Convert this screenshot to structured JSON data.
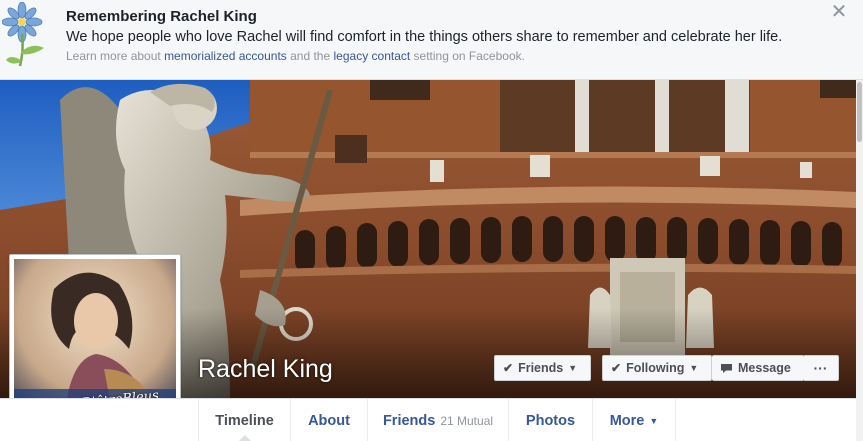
{
  "memorial": {
    "title": "Remembering Rachel King",
    "message": "We hope people who love Rachel will find comfort in the things others share to remember and celebrate her life.",
    "learn_prefix": "Learn more about ",
    "link_memorialized": "memorialized accounts",
    "learn_middle": " and the ",
    "link_legacy": "legacy contact",
    "learn_suffix": " setting on Facebook.",
    "close_glyph": "✕"
  },
  "profile": {
    "name": "Rachel King",
    "avatar_caption": "FiersD'êtreBleus"
  },
  "actions": {
    "friends_label": "Friends",
    "following_label": "Following",
    "message_label": "Message",
    "more_glyph": "···"
  },
  "tabs": {
    "timeline": "Timeline",
    "about": "About",
    "friends": "Friends",
    "friends_mutual": "21 Mutual",
    "photos": "Photos",
    "more": "More"
  },
  "icons": {
    "flower": "flower-icon",
    "check": "check-icon",
    "caret": "caret-down-icon",
    "message": "message-icon",
    "close": "close-icon"
  },
  "colors": {
    "link": "#365899",
    "banner_bg": "#f6f7f9",
    "text": "#1d2129",
    "muted": "#90949c"
  }
}
